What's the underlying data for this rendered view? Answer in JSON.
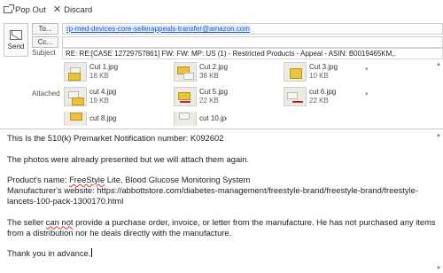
{
  "toolbar": {
    "popout_label": "Pop Out",
    "discard_label": "Discard"
  },
  "compose": {
    "send_label": "Send",
    "to_label": "To...",
    "to_value": "rp-med-devices-core-sellerappeals-transfer@amazon.com",
    "cc_label": "Cc...",
    "cc_value": "",
    "subject_label": "Subject",
    "subject_value": "RE: RE:[CASE 12729757861] FW: FW: MP: US (1) - Restricted Products - Appeal - ASIN:  B0019465KM,."
  },
  "attachments": {
    "label": "Attached",
    "items": [
      {
        "name": "Cut 1.jpg",
        "size": "18 KB"
      },
      {
        "name": "Cut 2.jpg",
        "size": "38 KB"
      },
      {
        "name": "Cut 3.jpg",
        "size": "10 KB"
      },
      {
        "name": "cut 4.jpg",
        "size": "19 KB"
      },
      {
        "name": "Cut 5.jpg",
        "size": "22 KB"
      },
      {
        "name": "cut 6.jpg",
        "size": "22 KB"
      },
      {
        "name": "cut 8.jpg",
        "size": ""
      },
      {
        "name": "cut 10.jpg",
        "size": ""
      }
    ]
  },
  "body": {
    "line1": "This Is the 510(k) Premarket Notification number:  K092602",
    "line2": "The photos were already presented but we will attach them again.",
    "product_prefix": "Product's name: ",
    "product_brand": "FreeStyle",
    "product_rest": " Lite, Blood Glucose Monitoring System",
    "website": "Manufacturer's website: https://abbottstore.com/diabetes-management/freestyle-brand/freestyle-brand/freestyle-lancets-100-pack-1300170.html",
    "seller_prefix": "The seller ",
    "seller_cannot": "can not",
    "seller_rest": " provide a purchase order, invoice, or letter from the manufacture. He has not purchased any items from a distribution nor he deals directly with the manufacture.",
    "thanks": "Thank you in advance."
  }
}
